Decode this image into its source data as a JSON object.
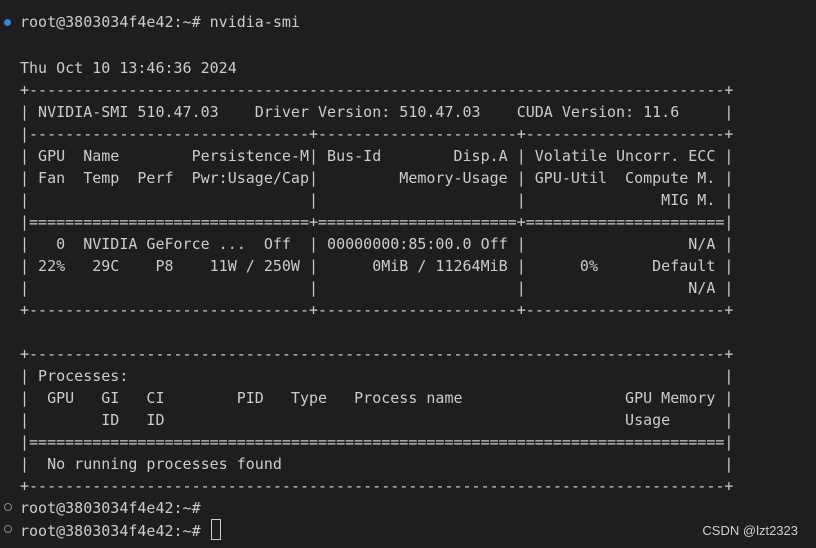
{
  "terminal": {
    "command_prompt": "root@3803034f4e42:~# nvidia-smi",
    "date_line": "Thu Oct 10 13:46:36 2024",
    "smi_lines": [
      "+-----------------------------------------------------------------------------+",
      "| NVIDIA-SMI 510.47.03    Driver Version: 510.47.03    CUDA Version: 11.6     |",
      "|-------------------------------+----------------------+----------------------+",
      "| GPU  Name        Persistence-M| Bus-Id        Disp.A | Volatile Uncorr. ECC |",
      "| Fan  Temp  Perf  Pwr:Usage/Cap|         Memory-Usage | GPU-Util  Compute M. |",
      "|                               |                      |               MIG M. |",
      "|===============================+======================+======================|",
      "|   0  NVIDIA GeForce ...  Off  | 00000000:85:00.0 Off |                  N/A |",
      "| 22%   29C    P8    11W / 250W |      0MiB / 11264MiB |      0%      Default |",
      "|                               |                      |                  N/A |",
      "+-------------------------------+----------------------+----------------------+"
    ],
    "proc_lines": [
      "+-----------------------------------------------------------------------------+",
      "| Processes:                                                                  |",
      "|  GPU   GI   CI        PID   Type   Process name                  GPU Memory |",
      "|        ID   ID                                                   Usage      |",
      "|=============================================================================|",
      "|  No running processes found                                                 |",
      "+-----------------------------------------------------------------------------+"
    ],
    "prompt_after_1": "root@3803034f4e42:~#",
    "prompt_current": "root@3803034f4e42:~# "
  },
  "watermark": "CSDN @lzt2323",
  "colors": {
    "background": "#1e1e1e",
    "text": "#cccccc",
    "decoration_active": "#2f87d6",
    "decoration_idle": "#8a8a8a"
  }
}
